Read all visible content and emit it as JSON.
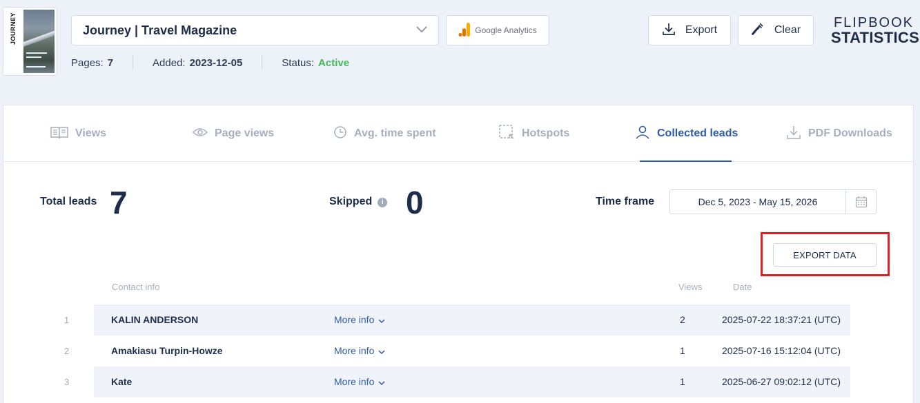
{
  "cover": {
    "spine_text": "JOURNEY"
  },
  "publication": {
    "title": "Journey | Travel Magazine",
    "pages_label": "Pages:",
    "pages_value": "7",
    "added_label": "Added:",
    "added_value": "2023-12-05",
    "status_label": "Status:",
    "status_value": "Active"
  },
  "ga_button": {
    "label": "Google Analytics"
  },
  "toolbar": {
    "export_label": "Export",
    "clear_label": "Clear"
  },
  "logo": {
    "line1": "FLIPBOOK",
    "line2": "STATISTICS"
  },
  "tabs": [
    {
      "label": "Views",
      "active": false
    },
    {
      "label": "Page views",
      "active": false
    },
    {
      "label": "Avg. time spent",
      "active": false
    },
    {
      "label": "Hotspots",
      "active": false
    },
    {
      "label": "Collected leads",
      "active": true
    },
    {
      "label": "PDF Downloads",
      "active": false
    }
  ],
  "stats": {
    "total_leads_label": "Total leads",
    "total_leads_value": "7",
    "skipped_label": "Skipped",
    "skipped_info": "i",
    "skipped_value": "0",
    "timeframe_label": "Time frame",
    "timeframe_value": "Dec 5, 2023 - May 15, 2026"
  },
  "export_data_label": "EXPORT DATA",
  "table": {
    "headers": {
      "contact": "Contact info",
      "views": "Views",
      "date": "Date"
    },
    "rows": [
      {
        "num": "1",
        "name": "KALIN ANDERSON",
        "more": "More info",
        "views": "2",
        "date": "2025-07-22 18:37:21 (UTC)"
      },
      {
        "num": "2",
        "name": "Amakiasu Turpin-Howze",
        "more": "More info",
        "views": "1",
        "date": "2025-07-16 15:12:04 (UTC)"
      },
      {
        "num": "3",
        "name": "Kate",
        "more": "More info",
        "views": "1",
        "date": "2025-06-27 09:02:12 (UTC)"
      }
    ]
  },
  "colors": {
    "accent": "#2d5da8",
    "status_active": "#46b85c",
    "highlight": "#e01f26",
    "text": "#1e2d4a",
    "muted": "#a7afbc"
  }
}
